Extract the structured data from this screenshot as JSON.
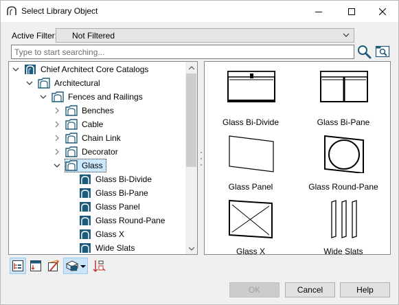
{
  "window": {
    "title": "Select Library Object"
  },
  "filter": {
    "label": "Active Filter:",
    "value": "Not Filtered"
  },
  "search": {
    "placeholder": "Type to start searching..."
  },
  "tree": {
    "items": [
      {
        "label": "Chief Architect Core Catalogs",
        "level": 0,
        "expanded": true,
        "expander": "down"
      },
      {
        "label": "Architectural",
        "level": 1,
        "expanded": true,
        "expander": "down"
      },
      {
        "label": "Fences and Railings",
        "level": 2,
        "expanded": true,
        "expander": "down"
      },
      {
        "label": "Benches",
        "level": 3,
        "expanded": false,
        "expander": "right"
      },
      {
        "label": "Cable",
        "level": 3,
        "expanded": false,
        "expander": "right"
      },
      {
        "label": "Chain Link",
        "level": 3,
        "expanded": false,
        "expander": "right"
      },
      {
        "label": "Decorator",
        "level": 3,
        "expanded": false,
        "expander": "right"
      },
      {
        "label": "Glass",
        "level": 3,
        "expanded": true,
        "expander": "down",
        "selected": true
      },
      {
        "label": "Glass Bi-Divide",
        "level": 4,
        "leaf": true
      },
      {
        "label": "Glass Bi-Pane",
        "level": 4,
        "leaf": true
      },
      {
        "label": "Glass Panel",
        "level": 4,
        "leaf": true
      },
      {
        "label": "Glass Round-Pane",
        "level": 4,
        "leaf": true
      },
      {
        "label": "Glass X",
        "level": 4,
        "leaf": true
      },
      {
        "label": "Wide Slats",
        "level": 4,
        "leaf": true
      }
    ]
  },
  "preview": {
    "tiles": [
      {
        "label": "Glass Bi-Divide",
        "icon": "glass-bi-divide-icon"
      },
      {
        "label": "Glass Bi-Pane",
        "icon": "glass-bi-pane-icon"
      },
      {
        "label": "Glass Panel",
        "icon": "glass-panel-icon"
      },
      {
        "label": "Glass Round-Pane",
        "icon": "glass-round-pane-icon"
      },
      {
        "label": "Glass X",
        "icon": "glass-x-icon"
      },
      {
        "label": "Wide Slats",
        "icon": "wide-slats-icon"
      }
    ]
  },
  "toolbar": {
    "buttons": [
      "show-tree-icon",
      "show-folders-icon",
      "show-preview-icon",
      "view-mode-icon",
      "sort-icon"
    ]
  },
  "buttons": {
    "ok": "OK",
    "cancel": "Cancel",
    "help": "Help"
  },
  "colors": {
    "selection": "#cce8ff",
    "folder_dark": "#1e5a7a",
    "accent": "#0078d7"
  }
}
